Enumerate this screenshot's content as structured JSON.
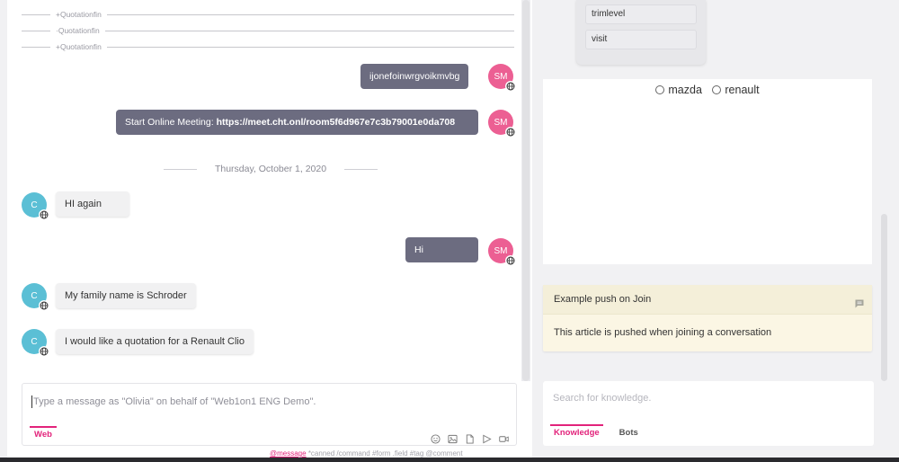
{
  "chat": {
    "system_lines": [
      "+Quotationfin",
      "·Quotationfin",
      "+Quotationfin"
    ],
    "messages": [
      {
        "from": "agent",
        "avatar": "SM",
        "text": "ijonefoinwrgvoikmvbg"
      },
      {
        "from": "agent",
        "avatar": "SM",
        "prefix": "Start Online Meeting: ",
        "link": "https://meet.cht.onl/room5f6d967e7c3b79001e0da708"
      },
      {
        "from": "agent",
        "avatar": "SM",
        "text": "Hi"
      },
      {
        "from": "customer",
        "avatar": "C",
        "text": "HI again"
      },
      {
        "from": "customer",
        "avatar": "C",
        "text": "My family name is Schroder"
      },
      {
        "from": "customer",
        "avatar": "C",
        "text": "I would like a quotation for a Renault Clio"
      }
    ],
    "date_separator": "Thursday, October 1, 2020"
  },
  "composer": {
    "placeholder": "Type a message as \"Olivia\"  on behalf of \"Web1on1 ENG Demo\".",
    "tab": "Web",
    "toolbar_icons": [
      "emoji-icon",
      "image-icon",
      "file-icon",
      "send-icon",
      "video-icon"
    ],
    "hints": {
      "first": "@message",
      "rest": " *canned  /command  #form  .field  #tag  @comment"
    }
  },
  "right": {
    "fields": [
      "trimlevel",
      "visit"
    ],
    "radio_options": [
      "mazda",
      "renault"
    ],
    "article": {
      "title": "Example push on Join",
      "body": "This article is pushed when joining a conversation"
    },
    "search": {
      "placeholder": "Search for knowledge.",
      "tabs": [
        "Knowledge",
        "Bots"
      ]
    }
  },
  "colors": {
    "accent": "#e2237b",
    "agent_bubble": "#6c6c80",
    "agent_avatar": "#ec5f93",
    "customer_avatar": "#5bbfd5"
  }
}
